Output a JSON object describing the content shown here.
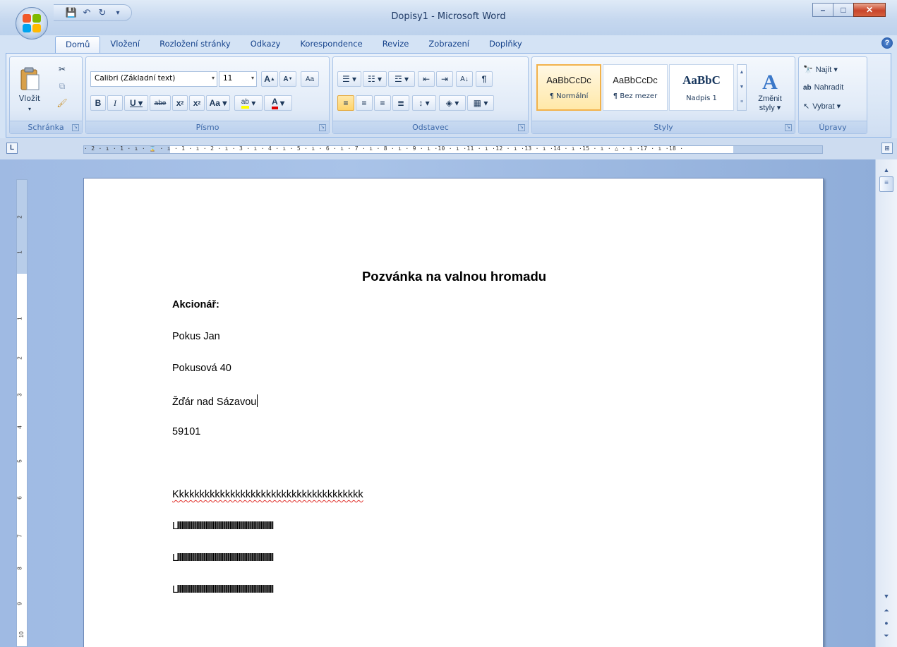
{
  "window": {
    "title": "Dopisy1 - Microsoft Word"
  },
  "qat": {
    "save_icon": "save-icon",
    "undo_icon": "undo-icon",
    "redo_icon": "redo-icon"
  },
  "tabs": [
    {
      "label": "Domů",
      "active": true
    },
    {
      "label": "Vložení"
    },
    {
      "label": "Rozložení stránky"
    },
    {
      "label": "Odkazy"
    },
    {
      "label": "Korespondence"
    },
    {
      "label": "Revize"
    },
    {
      "label": "Zobrazení"
    },
    {
      "label": "Doplňky"
    }
  ],
  "ribbon": {
    "clipboard": {
      "label": "Schránka",
      "paste_label": "Vložit"
    },
    "font": {
      "label": "Písmo",
      "font_name": "Calibri (Základní text)",
      "font_size": "11"
    },
    "paragraph": {
      "label": "Odstavec"
    },
    "styles": {
      "label": "Styly",
      "items": [
        {
          "preview": "AaBbCcDc",
          "name": "¶ Normální",
          "selected": true
        },
        {
          "preview": "AaBbCcDc",
          "name": "¶ Bez mezer"
        },
        {
          "preview": "AaBbC",
          "name": "Nadpis 1"
        }
      ],
      "change_label_1": "Změnit",
      "change_label_2": "styly ▾"
    },
    "editing": {
      "label": "Úpravy",
      "find": "Najít ▾",
      "replace": "Nahradit",
      "select": "Vybrat ▾"
    }
  },
  "ruler": {
    "numbers": "· 2 · ı · 1 · ı · ⌛ · ı · 1 · ı · 2 · ı · 3 · ı · 4 · ı · 5 · ı · 6 · ı · 7 · ı · 8 · ı · 9 · ı ·10 · ı ·11 · ı ·12 · ı ·13 · ı ·14 · ı ·15 · ı · △ · ı ·17 · ı ·18 ·"
  },
  "document": {
    "title": "Pozvánka na valnou hromadu",
    "lines": [
      "Akcionář:",
      "Pokus Jan",
      "Pokusová 40",
      "Žďár nad Sázavou",
      "59101",
      "Kkkkkkkkkkkkkkkkkkkkkkkkkkkkkkkkkkkkk",
      "Lllllllllllllllllllllllllllllllllllllllllllllllllllllllllllllllllllllllllllllllllllll",
      "Lllllllllllllllllllllllllllllllllllllllllllllllllllllllllllllllllllllllllllllllllllll",
      "Lllllllllllllllllllllllllllllllllllllllllllllllllllllllllllllllllllllllllllllllllllll"
    ]
  },
  "colors": {
    "accent": "#15428b",
    "selected_style": "#ffe8a8",
    "spell_error": "#e0302a"
  }
}
